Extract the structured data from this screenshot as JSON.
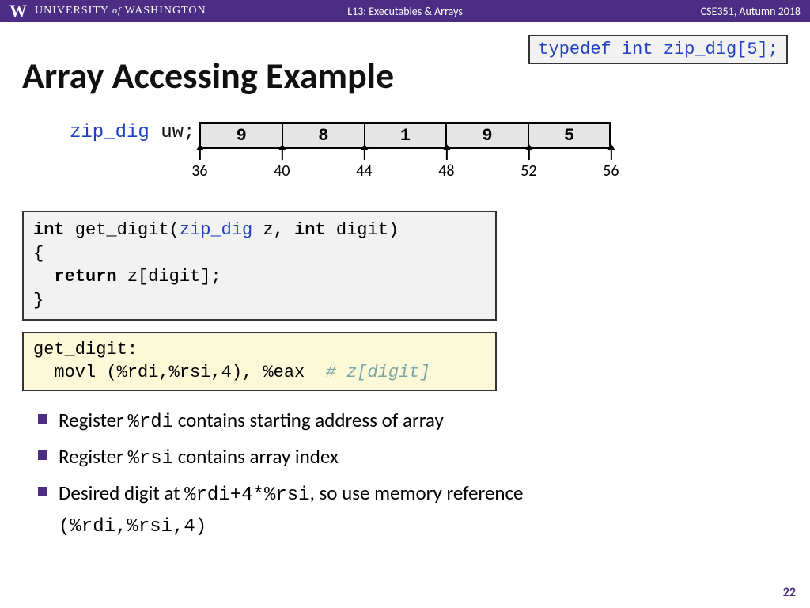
{
  "header": {
    "logo_letter": "W",
    "university_pre": "UNIVERSITY",
    "university_of": "of",
    "university_post": "WASHINGTON",
    "lecture": "L13:  Executables & Arrays",
    "course": "CSE351, Autumn 2018"
  },
  "typedef": {
    "kw": "typedef",
    "int": "int",
    "rest": " zip_dig[5];"
  },
  "title": "Array Accessing Example",
  "decl": {
    "type": "zip_dig",
    "name": " uw;"
  },
  "array": {
    "values": [
      "9",
      "8",
      "1",
      "9",
      "5"
    ],
    "addresses": [
      "36",
      "40",
      "44",
      "48",
      "52",
      "56"
    ]
  },
  "c_code": {
    "l1a": "int",
    "l1b": " get_digit(",
    "l1c": "zip_dig",
    "l1d": " z, ",
    "l1e": "int",
    "l1f": " digit)",
    "l2": "{",
    "l3a": "  ",
    "l3b": "return",
    "l3c": " z[digit];",
    "l4": "}"
  },
  "asm": {
    "label": "get_digit:",
    "instr": "  movl (%rdi,%rsi,4), %eax  ",
    "comment": "# z[digit]"
  },
  "bullets": {
    "b1a": "Register ",
    "b1b": "%rdi",
    "b1c": " contains starting address of array",
    "b2a": "Register ",
    "b2b": "%rsi",
    "b2c": " contains array index",
    "b3a": "Desired digit at ",
    "b3b": "%rdi+4*%rsi",
    "b3c": ", so use memory reference ",
    "b3d": "(%rdi,%rsi,4)"
  },
  "page": "22"
}
